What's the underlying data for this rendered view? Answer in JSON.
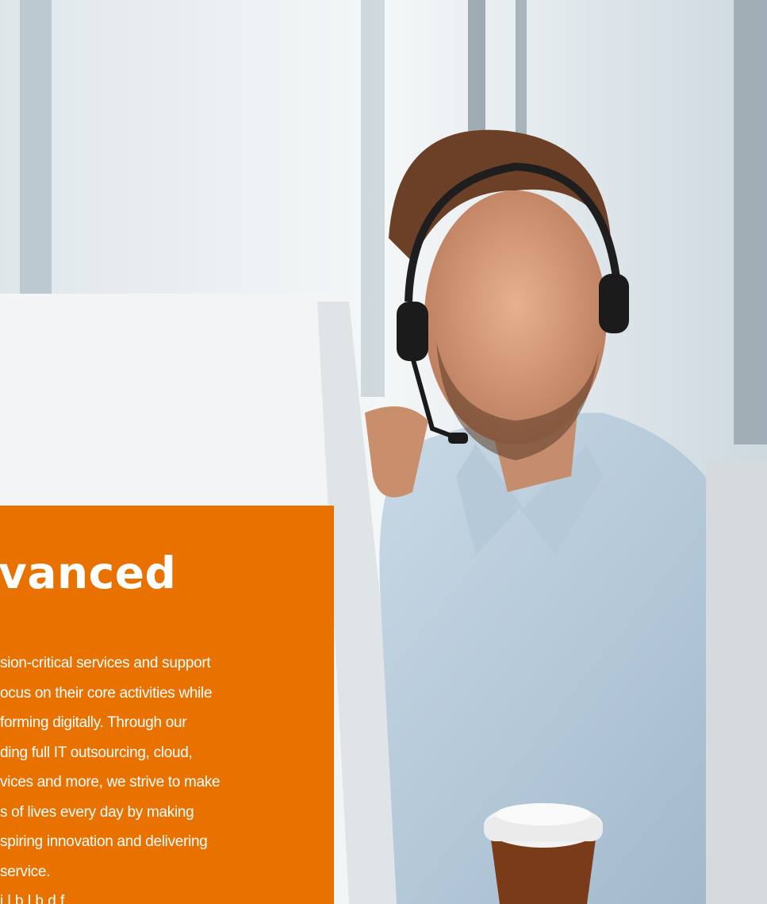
{
  "hero": {
    "image_subject": "man wearing headset smiling at monitor with coffee cup"
  },
  "panel": {
    "background": "#e87100",
    "heading": "vanced",
    "body_lines": [
      "sion-critical services and support",
      "ocus on their core activities while",
      "forming digitally. Through our",
      "ding full IT outsourcing, cloud,",
      "vices and more, we strive to make",
      "s of lives every day by making",
      "spiring innovation and delivering",
      "service."
    ],
    "body_next_partial": "i        l b l b    d    f"
  }
}
